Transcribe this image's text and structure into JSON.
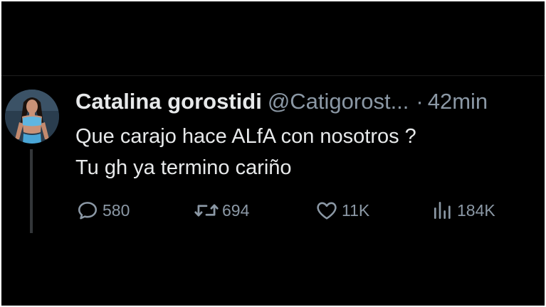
{
  "tweet": {
    "display_name": "Catalina gorostidi",
    "handle": "@Catigorost...",
    "separator": "·",
    "time": "42min",
    "text_lines": [
      "Que carajo hace ALfA con nosotros ?",
      "Tu gh ya termino cariño"
    ]
  },
  "actions": {
    "replies": "580",
    "retweets": "694",
    "likes": "11K",
    "views": "184K"
  },
  "icons": {
    "reply": "speech-bubble-icon",
    "retweet": "retweet-arrows-icon",
    "like": "heart-icon",
    "views": "bar-chart-icon",
    "avatar": "profile-photo"
  },
  "colors": {
    "background": "#000000",
    "primary_text": "#e7e9ea",
    "secondary_text": "#8b98a5",
    "thread_line": "#333639"
  }
}
